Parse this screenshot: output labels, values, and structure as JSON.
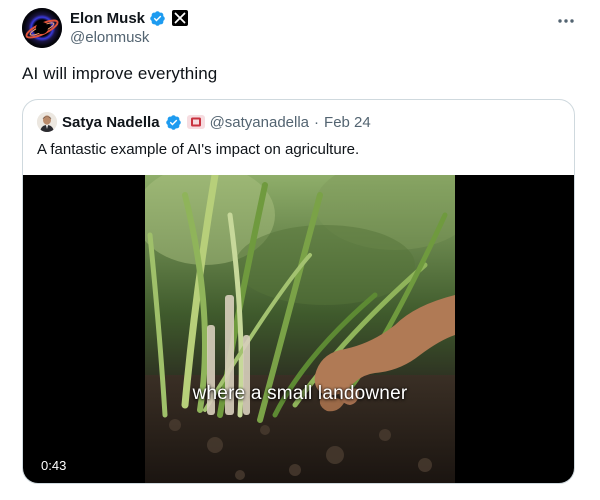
{
  "author": {
    "name": "Elon Musk",
    "handle": "@elonmusk",
    "avatar_icon": "black-hole-avatar",
    "verified_icon": "verified-badge-icon",
    "affiliation_icon": "x-logo-icon"
  },
  "tweet": {
    "text": "AI will improve everything"
  },
  "more_icon": "more-horizontal-icon",
  "quote": {
    "name": "Satya Nadella",
    "handle": "@satyanadella",
    "separator": "·",
    "date": "Feb 24",
    "text": "A fantastic example of AI's impact on agriculture.",
    "avatar_icon": "person-avatar",
    "verified_icon": "verified-badge-icon",
    "affiliation_icon": "microsoft-badge-icon"
  },
  "video": {
    "caption": "where a small landowner",
    "duration": "0:43"
  },
  "colors": {
    "text_primary": "#0f1419",
    "text_secondary": "#536471",
    "verified_blue": "#1d9bf0",
    "border": "#cfd9de"
  }
}
